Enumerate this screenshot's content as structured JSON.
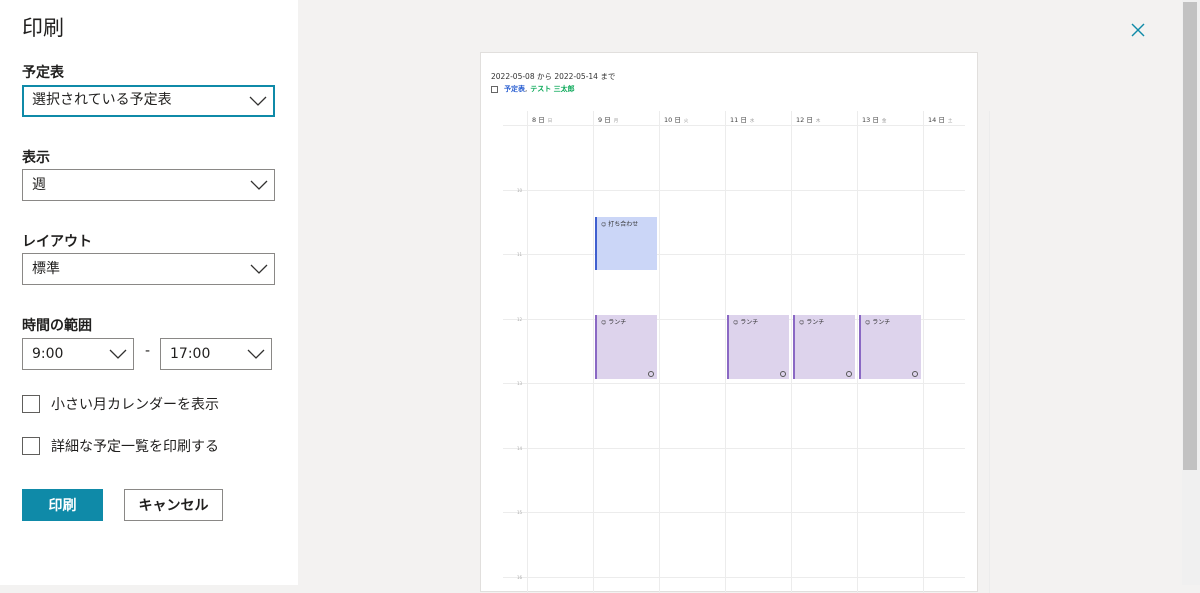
{
  "dialog": {
    "title": "印刷",
    "calendar_label": "予定表",
    "calendar_value": "選択されている予定表",
    "view_label": "表示",
    "view_value": "週",
    "layout_label": "レイアウト",
    "layout_value": "標準",
    "time_range_label": "時間の範囲",
    "start_time": "9:00",
    "end_time": "17:00",
    "range_separator": "-",
    "mini_calendar_label": "小さい月カレンダーを表示",
    "mini_calendar_checked": false,
    "detailed_list_label": "詳細な予定一覧を印刷する",
    "detailed_list_checked": false,
    "print_button": "印刷",
    "cancel_button": "キャンセル"
  },
  "preview": {
    "date_range": "2022-05-08 から 2022-05-14 まで",
    "calendar_name": "予定表",
    "calendar_separator": ",",
    "calendar_owner": "テスト 三太郎",
    "days": [
      {
        "date": "8 日",
        "dow": "日"
      },
      {
        "date": "9 日",
        "dow": "月"
      },
      {
        "date": "10 日",
        "dow": "火"
      },
      {
        "date": "11 日",
        "dow": "水"
      },
      {
        "date": "12 日",
        "dow": "木"
      },
      {
        "date": "13 日",
        "dow": "金"
      },
      {
        "date": "14 日",
        "dow": "土"
      }
    ],
    "hours": [
      "10",
      "11",
      "12",
      "13",
      "14",
      "15",
      "16"
    ],
    "events": [
      {
        "title": "打ち合わせ",
        "day_index": 1,
        "color": "blue"
      },
      {
        "title": "ランチ",
        "day_index": 1,
        "color": "purple",
        "recurring": true
      },
      {
        "title": "ランチ",
        "day_index": 3,
        "color": "purple",
        "recurring": true
      },
      {
        "title": "ランチ",
        "day_index": 4,
        "color": "purple",
        "recurring": true
      },
      {
        "title": "ランチ",
        "day_index": 5,
        "color": "purple",
        "recurring": true
      }
    ]
  },
  "colors": {
    "accent": "#0f8aa8",
    "event_blue": "#cbd6f7",
    "event_purple": "#ddd3ec"
  }
}
